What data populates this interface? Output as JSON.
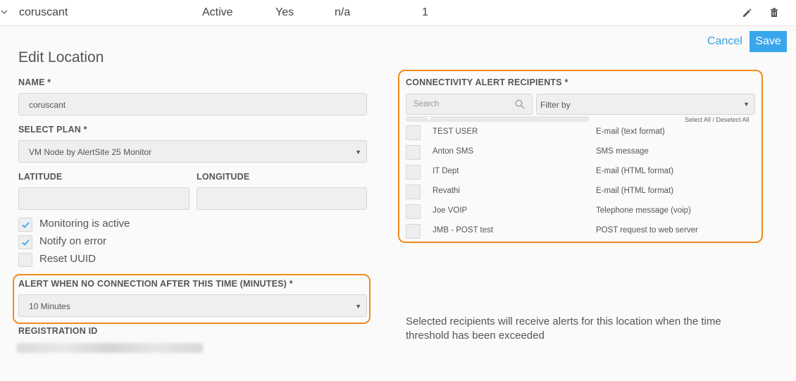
{
  "row": {
    "name": "coruscant",
    "status": "Active",
    "enabled": "Yes",
    "na": "n/a",
    "count": "1",
    "expand_icon": "chevron-down-icon",
    "edit_icon": "pencil-icon",
    "delete_icon": "trash-icon"
  },
  "actions": {
    "cancel": "Cancel",
    "save": "Save",
    "save_color": "#39a6ec",
    "cancel_color": "#3aa0e0"
  },
  "form": {
    "title": "Edit Location",
    "name_label": "NAME *",
    "name_value": "coruscant",
    "plan_label": "SELECT PLAN *",
    "plan_value": "VM Node by AlertSite 25 Monitor",
    "latitude_label": "LATITUDE",
    "latitude_value": "",
    "longitude_label": "LONGITUDE",
    "longitude_value": "",
    "checkboxes": [
      {
        "label": "Monitoring is active",
        "checked": true
      },
      {
        "label": "Notify on error",
        "checked": true
      },
      {
        "label": "Reset UUID",
        "checked": false
      }
    ],
    "alert_label": "ALERT WHEN NO CONNECTION AFTER THIS TIME (MINUTES) *",
    "alert_value": "10 Minutes",
    "registration_label": "REGISTRATION ID"
  },
  "recipients": {
    "label": "CONNECTIVITY ALERT RECIPIENTS *",
    "search_placeholder": "Search",
    "filter_value": "Filter by",
    "select_all": "Select All / Deselect All",
    "items": [
      {
        "name": "TEST USER",
        "type": "E-mail (text format)"
      },
      {
        "name": "Anton SMS",
        "type": "SMS message"
      },
      {
        "name": "IT Dept",
        "type": "E-mail (HTML format)"
      },
      {
        "name": "Revathi",
        "type": "E-mail (HTML format)"
      },
      {
        "name": "Joe VOIP",
        "type": "Telephone message (voip)"
      },
      {
        "name": "JMB - POST test",
        "type": "POST request to web server"
      }
    ],
    "note": "Selected recipients will receive alerts for this location when the time threshold has been exceeded"
  },
  "highlight_color": "#f28a1c"
}
